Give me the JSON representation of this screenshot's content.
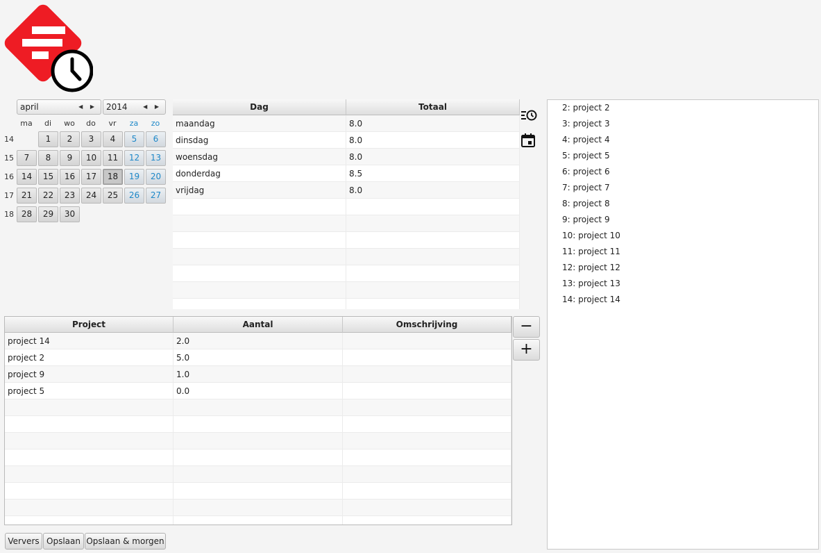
{
  "calendar": {
    "month": "april",
    "year": "2014",
    "weekday_headers": [
      "ma",
      "di",
      "wo",
      "do",
      "vr",
      "za",
      "zo"
    ],
    "weeks": [
      {
        "number": "14",
        "days": [
          "",
          "",
          "1",
          "2",
          "3",
          "4",
          "5",
          "6"
        ]
      },
      {
        "number": "15",
        "days": [
          "7",
          "8",
          "9",
          "10",
          "11",
          "12",
          "13"
        ]
      },
      {
        "number": "16",
        "days": [
          "14",
          "15",
          "16",
          "17",
          "18",
          "19",
          "20"
        ]
      },
      {
        "number": "17",
        "days": [
          "21",
          "22",
          "23",
          "24",
          "25",
          "26",
          "27"
        ]
      },
      {
        "number": "18",
        "days": [
          "28",
          "29",
          "30"
        ]
      }
    ],
    "selected_day": "18",
    "weekend_color": "#1e88c8"
  },
  "days_table": {
    "columns": [
      "Dag",
      "Totaal"
    ],
    "rows": [
      [
        "maandag",
        "8.0"
      ],
      [
        "dinsdag",
        "8.0"
      ],
      [
        "woensdag",
        "8.0"
      ],
      [
        "donderdag",
        "8.5"
      ],
      [
        "vrijdag",
        "8.0"
      ]
    ]
  },
  "icons": {
    "logo": "app-logo-icon",
    "history": "history-list-icon",
    "calendar": "calendar-today-icon",
    "brand_color": "#ee1c24"
  },
  "project_table": {
    "columns": [
      "Project",
      "Aantal",
      "Omschrijving"
    ],
    "rows": [
      [
        "project 14",
        "2.0",
        ""
      ],
      [
        "project 2",
        "5.0",
        ""
      ],
      [
        "project 9",
        "1.0",
        ""
      ],
      [
        "project 5",
        "0.0",
        ""
      ]
    ]
  },
  "row_buttons": {
    "remove": "−",
    "add": "+"
  },
  "buttons": {
    "refresh": "Ververs",
    "save": "Opslaan",
    "save_tomorrow": "Opslaan & morgen"
  },
  "project_list": [
    "2: project 2",
    "3: project 3",
    "4: project 4",
    "5: project 5",
    "6: project 6",
    "7: project 7",
    "8: project 8",
    "9: project 9",
    "10: project 10",
    "11: project 11",
    "12: project 12",
    "13: project 13",
    "14: project 14"
  ]
}
